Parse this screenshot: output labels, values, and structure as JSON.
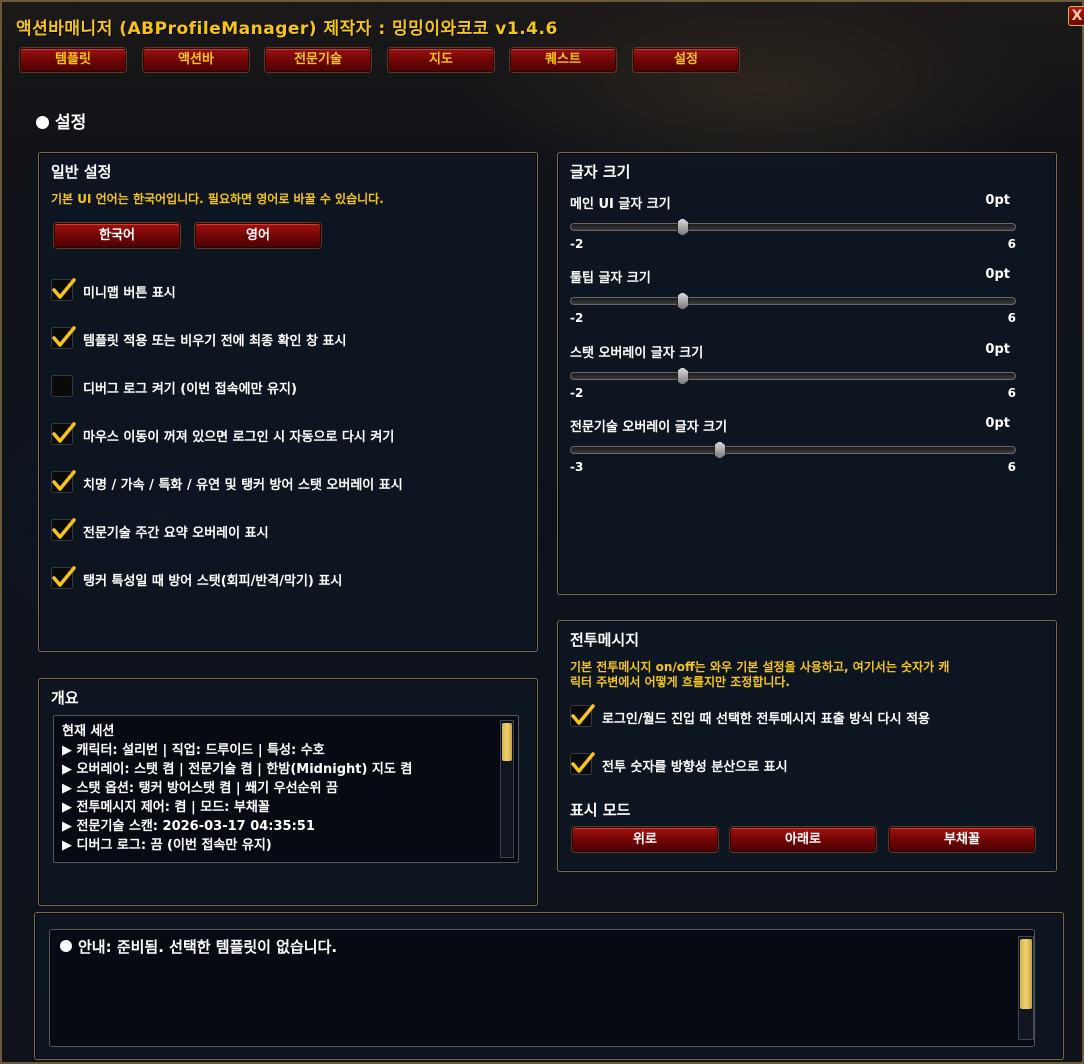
{
  "window": {
    "title": "액션바매니저 (ABProfileManager) 제작자 : 밍밍이와코코  v1.4.6",
    "close_label": "X"
  },
  "tabs": [
    {
      "label": "템플릿"
    },
    {
      "label": "액션바"
    },
    {
      "label": "전문기술"
    },
    {
      "label": "지도"
    },
    {
      "label": "퀘스트"
    },
    {
      "label": "설정"
    }
  ],
  "page_title": "설정",
  "general": {
    "title": "일반 설정",
    "description": "기본 UI 언어는 한국어입니다. 필요하면 영어로 바꿀 수 있습니다.",
    "lang_buttons": [
      "한국어",
      "영어"
    ],
    "options": [
      {
        "label": "미니맵 버튼 표시",
        "checked": true
      },
      {
        "label": "템플릿 적용 또는 비우기 전에 최종 확인 창 표시",
        "checked": true
      },
      {
        "label": "디버그 로그 켜기 (이번 접속에만 유지)",
        "checked": false
      },
      {
        "label": "마우스 이동이 꺼져 있으면 로그인 시 자동으로 다시 켜기",
        "checked": true
      },
      {
        "label": "치명 / 가속 / 특화 / 유연 및 탱커 방어 스탯 오버레이 표시",
        "checked": true
      },
      {
        "label": "전문기술 주간 요약 오버레이 표시",
        "checked": true
      },
      {
        "label": "탱커 특성일 때 방어 스탯(회피/반격/막기) 표시",
        "checked": true
      }
    ]
  },
  "font_size": {
    "title": "글자 크기",
    "sliders": [
      {
        "label": "메인 UI 글자 크기",
        "value": "0pt",
        "min": "-2",
        "max": "6",
        "min_num": -2,
        "max_num": 6,
        "current": 0
      },
      {
        "label": "툴팁 글자 크기",
        "value": "0pt",
        "min": "-2",
        "max": "6",
        "min_num": -2,
        "max_num": 6,
        "current": 0
      },
      {
        "label": "스탯 오버레이 글자 크기",
        "value": "0pt",
        "min": "-2",
        "max": "6",
        "min_num": -2,
        "max_num": 6,
        "current": 0
      },
      {
        "label": "전문기술 오버레이 글자 크기",
        "value": "0pt",
        "min": "-3",
        "max": "6",
        "min_num": -3,
        "max_num": 6,
        "current": 0
      }
    ]
  },
  "combat": {
    "title": "전투메시지",
    "description_line1": "기본 전투메시지 on/off는 와우 기본 설정을 사용하고, 여기서는 숫자가 캐",
    "description_line2": "릭터 주변에서 어떻게 흐를지만 조정합니다.",
    "options": [
      {
        "label": "로그인/월드 진입 때 선택한 전투메시지 표출 방식 다시 적용",
        "checked": true
      },
      {
        "label": "전투 숫자를 방향성 분산으로 표시",
        "checked": true
      }
    ],
    "mode_title": "표시 모드",
    "mode_buttons": [
      "위로",
      "아래로",
      "부채꼴"
    ]
  },
  "overview": {
    "title": "개요",
    "lines": [
      "현재 세션",
      "▶ 캐릭터: 설리번 | 직업: 드루이드 | 특성: 수호",
      "▶ 오버레이: 스탯 켬 | 전문기술 켬 | 한밤(Midnight) 지도 켬",
      "▶ 스탯 옵션: 탱커 방어스탯 켬 | 쐐기 우선순위 끔",
      "▶ 전투메시지 제어: 켬 | 모드: 부채꼴",
      "▶ 전문기술 스캔: 2026-03-17 04:35:51",
      "▶ 디버그 로그: 끔 (이번 접속만 유지)"
    ]
  },
  "notice": {
    "text": "안내: 준비됨. 선택한 템플릿이 없습니다."
  }
}
